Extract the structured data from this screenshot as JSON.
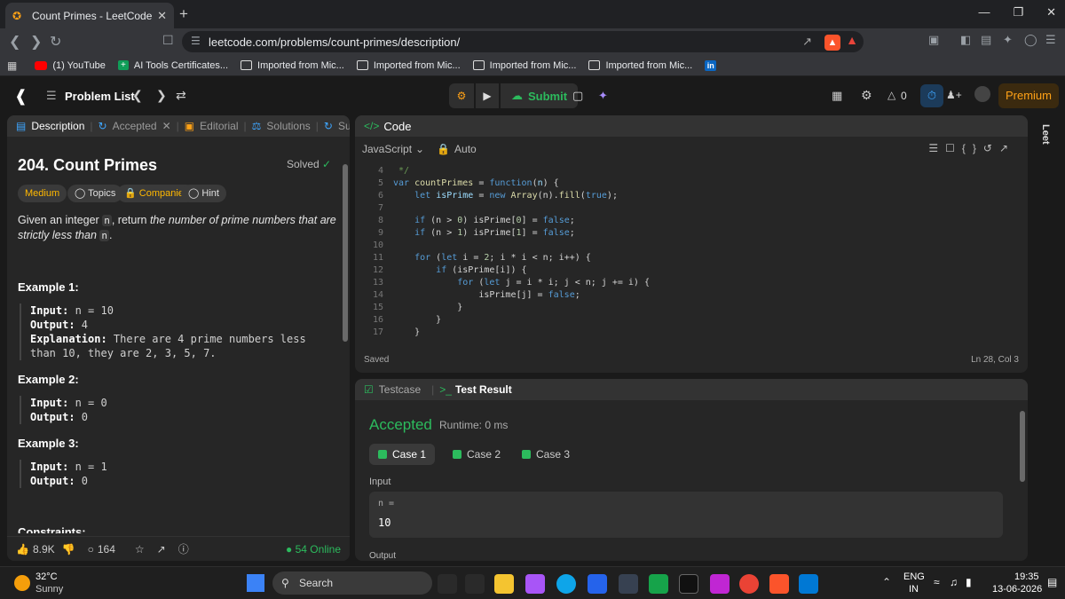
{
  "browser": {
    "tab_title": "Count Primes - LeetCode",
    "url": "leetcode.com/problems/count-primes/description/",
    "bookmarks": [
      "(1) YouTube",
      "AI Tools Certificates...",
      "Imported from Mic...",
      "Imported from Mic...",
      "Imported from Mic...",
      "Imported from Mic..."
    ]
  },
  "lc_nav": {
    "problem_list": "Problem List",
    "submit": "Submit",
    "coins": "0",
    "premium": "Premium"
  },
  "left_tabs": [
    "Description",
    "Accepted",
    "Editorial",
    "Solutions",
    "Submi"
  ],
  "problem": {
    "title": "204. Count Primes",
    "solved": "Solved",
    "difficulty": "Medium",
    "tags": [
      "Topics",
      "Companies",
      "Hint"
    ],
    "desc_a": "Given an integer",
    "desc_n": "n",
    "desc_b": ", return",
    "desc_c": "the number of prime numbers that are strictly less than",
    "desc_n2": "n",
    "desc_end": "."
  },
  "examples": [
    {
      "head": "Example 1:",
      "lines": [
        [
          "Input:",
          " n = 10"
        ],
        [
          "Output:",
          " 4"
        ],
        [
          "Explanation:",
          " There are 4 prime numbers less than 10, they are 2, 3, 5, 7."
        ]
      ]
    },
    {
      "head": "Example 2:",
      "lines": [
        [
          "Input:",
          " n = 0"
        ],
        [
          "Output:",
          " 0"
        ]
      ]
    },
    {
      "head": "Example 3:",
      "lines": [
        [
          "Input:",
          " n = 1"
        ],
        [
          "Output:",
          " 0"
        ]
      ]
    }
  ],
  "constraints_head": "Constraints:",
  "left_footer": {
    "likes": "8.9K",
    "comments": "164",
    "online": "54 Online"
  },
  "code_panel": {
    "title": "Code",
    "language": "JavaScript",
    "mode": "Auto",
    "line_numbers": [
      "4",
      "5",
      "6",
      "7",
      "8",
      "9",
      "10",
      "11",
      "12",
      "13",
      "14",
      "15",
      "16",
      "17"
    ],
    "saved": "Saved",
    "cursor": "Ln 28, Col 3"
  },
  "test_panel": {
    "tab_testcase": "Testcase",
    "tab_result": "Test Result",
    "status": "Accepted",
    "runtime": "Runtime: 0 ms",
    "cases": [
      "Case 1",
      "Case 2",
      "Case 3"
    ],
    "input_label": "Input",
    "input_var": "n =",
    "input_val": "10",
    "output_label": "Output"
  },
  "taskbar": {
    "temp": "32°C",
    "weather": "Sunny",
    "search": "Search",
    "lang1": "ENG",
    "lang2": "IN",
    "time": "19:35",
    "date": "13-06-2026"
  },
  "side_label": "Leet",
  "colors": {
    "accent": "#ffa116",
    "green": "#2cbb5d"
  }
}
